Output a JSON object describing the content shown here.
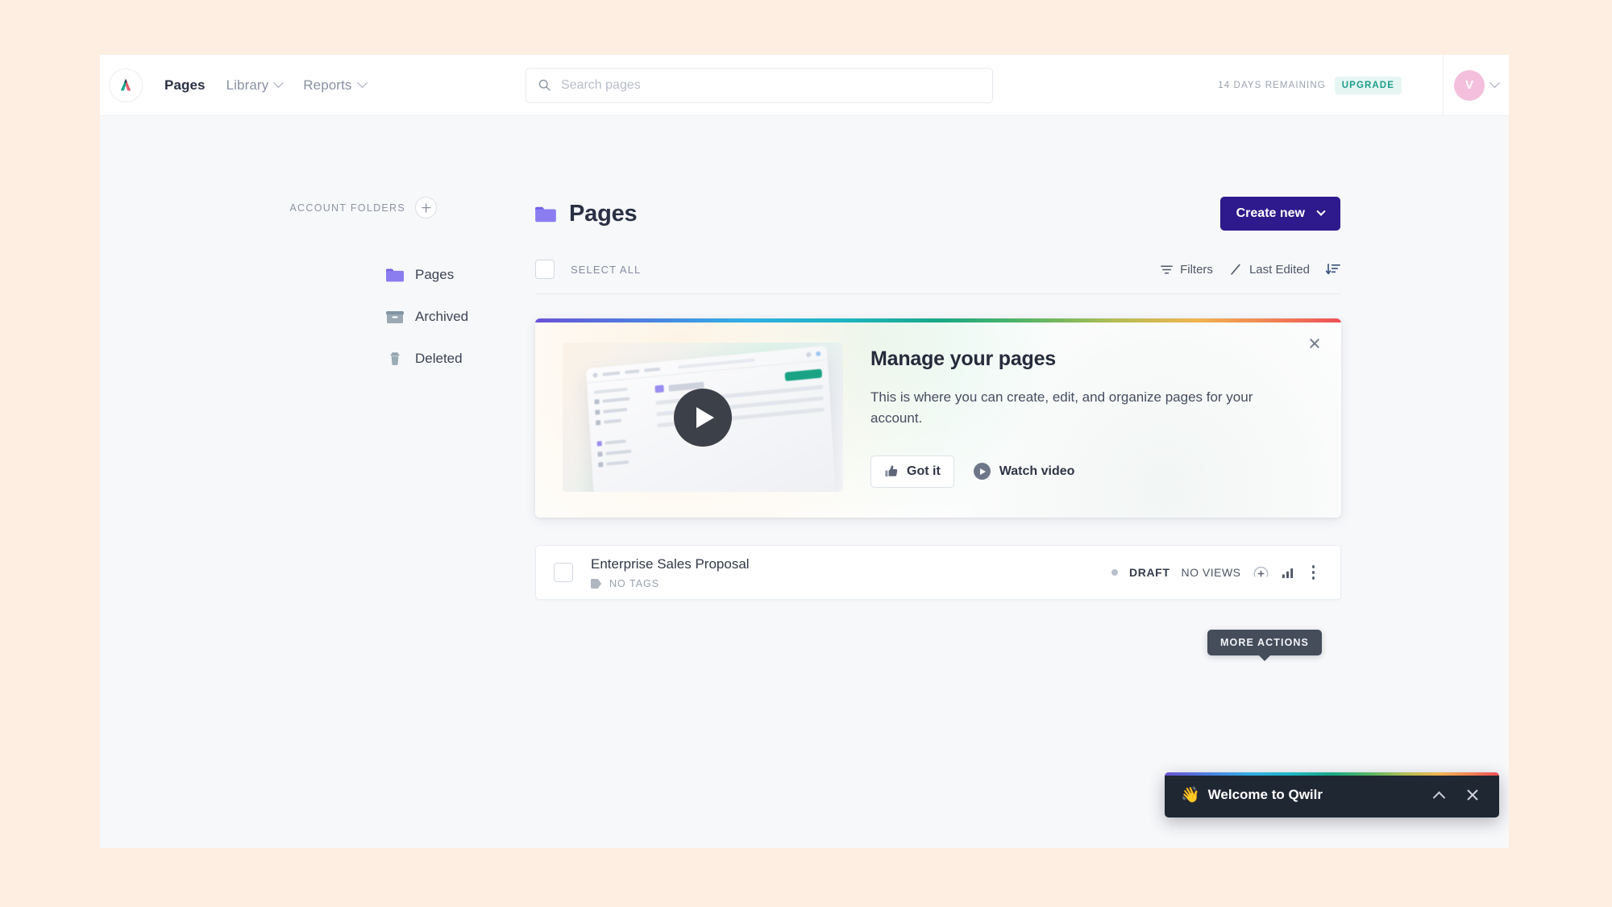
{
  "theme": {
    "outer_background": "#fdeee1",
    "app_background": "#f7f8fa",
    "accent_primary": "#2e1a8c",
    "accent_teal": "#1d9e8a",
    "avatar_color": "#f3bfdc",
    "folder_purple": "#8b7df0",
    "toast_background": "#1f2733",
    "tooltip_background": "#454d5b"
  },
  "topnav": {
    "logo_icon": "qwilr-logo-icon",
    "links": [
      {
        "label": "Pages",
        "active": true,
        "has_caret": false
      },
      {
        "label": "Library",
        "active": false,
        "has_caret": true
      },
      {
        "label": "Reports",
        "active": false,
        "has_caret": true
      }
    ],
    "search": {
      "icon": "search-icon",
      "placeholder": "Search pages",
      "value": ""
    },
    "trial": {
      "days_text": "14 DAYS REMAINING",
      "upgrade_label": "UPGRADE"
    },
    "account": {
      "avatar_initial": "V",
      "caret_icon": "chevron-down-icon"
    }
  },
  "sidebar": {
    "section_label": "ACCOUNT FOLDERS",
    "add_button_icon": "plus-icon",
    "items": [
      {
        "label": "Pages",
        "icon": "folder-icon",
        "active": true
      },
      {
        "label": "Archived",
        "icon": "archive-icon",
        "active": false
      },
      {
        "label": "Deleted",
        "icon": "trash-icon",
        "active": false
      }
    ]
  },
  "main": {
    "page_icon": "folder-icon",
    "page_title": "Pages",
    "create_button": {
      "label": "Create new",
      "caret_icon": "chevron-down-icon"
    },
    "toolbar": {
      "select_all_label": "SELECT ALL",
      "select_all_checked": false,
      "filters_label": "Filters",
      "filters_icon": "filter-icon",
      "sort_label": "Last Edited",
      "sort_icon": "pencil-icon",
      "sort_direction_icon": "sort-descending-icon"
    },
    "onboarding_card": {
      "title": "Manage your pages",
      "body": "This is where you can create, edit, and organize pages for your account.",
      "close_icon": "close-icon",
      "play_icon": "play-icon",
      "got_it": {
        "label": "Got it",
        "icon": "thumbs-up-icon"
      },
      "watch_video": {
        "label": "Watch video",
        "icon": "play-circle-icon"
      }
    },
    "tooltip": {
      "label": "MORE ACTIONS"
    },
    "page_list": [
      {
        "title": "Enterprise Sales Proposal",
        "tags_icon": "tag-icon",
        "tags_label": "NO TAGS",
        "status": "DRAFT",
        "views": "NO VIEWS",
        "checked": false,
        "action_icons": [
          "add-collaborator-icon",
          "analytics-icon",
          "more-actions-icon"
        ]
      }
    ]
  },
  "toast": {
    "emoji": "👋",
    "title": "Welcome to Qwilr",
    "collapse_icon": "chevron-up-icon",
    "close_icon": "close-icon"
  }
}
